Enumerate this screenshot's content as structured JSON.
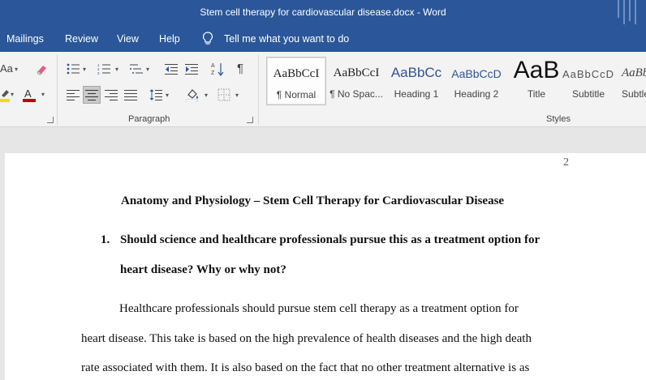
{
  "window": {
    "title": "Stem cell therapy for cardiovascular disease.docx  -  Word"
  },
  "menu": {
    "tabs": [
      "Mailings",
      "Review",
      "View",
      "Help"
    ],
    "tell_me": "Tell me what you want to do"
  },
  "ribbon": {
    "groups": {
      "paragraph": "Paragraph",
      "styles": "Styles"
    },
    "font_case_label": "Aa",
    "styles": [
      {
        "sample": "AaBbCcI",
        "name": "¶ Normal"
      },
      {
        "sample": "AaBbCcI",
        "name": "¶ No Spac..."
      },
      {
        "sample": "AaBbCc",
        "name": "Heading 1"
      },
      {
        "sample": "AaBbCcD",
        "name": "Heading 2"
      },
      {
        "sample": "AaB",
        "name": "Title"
      },
      {
        "sample": "AaBbCcD",
        "name": "Subtitle"
      },
      {
        "sample": "AaBbC",
        "name": "Subtle"
      }
    ],
    "colors": {
      "highlight": "#ffd700",
      "font_color": "#c00000",
      "accent": "#2b579a"
    }
  },
  "document": {
    "page_number": "2",
    "heading": "Anatomy and Physiology – Stem Cell Therapy for Cardiovascular Disease",
    "question_number": "1.",
    "question_line1": "Should science and healthcare professionals pursue this as a treatment option for",
    "question_line2": "heart disease? Why or why not?",
    "body_lines": [
      "Healthcare professionals should pursue stem cell therapy as a treatment option for",
      "heart disease. This take is based on the high prevalence of health diseases and the high death",
      "rate associated with them. It is also based on the fact that no other treatment alternative is as"
    ]
  }
}
